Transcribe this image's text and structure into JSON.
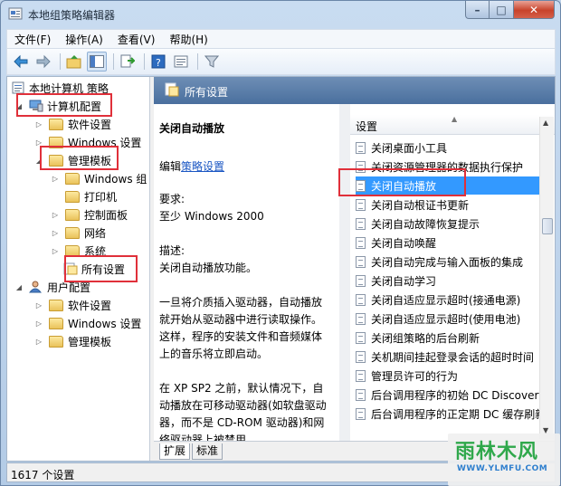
{
  "window": {
    "title": "本地组策略编辑器"
  },
  "menu": [
    "文件(F)",
    "操作(A)",
    "查看(V)",
    "帮助(H)"
  ],
  "tree": {
    "root": "本地计算机 策略",
    "items": [
      {
        "label": "计算机配置"
      },
      {
        "label": "软件设置"
      },
      {
        "label": "Windows 设置"
      },
      {
        "label": "管理模板"
      },
      {
        "label": "Windows 组"
      },
      {
        "label": "打印机"
      },
      {
        "label": "控制面板"
      },
      {
        "label": "网络"
      },
      {
        "label": "系统"
      },
      {
        "label": "所有设置"
      },
      {
        "label": "用户配置"
      },
      {
        "label": "软件设置"
      },
      {
        "label": "Windows 设置"
      },
      {
        "label": "管理模板"
      }
    ]
  },
  "right_header": "所有设置",
  "description": {
    "title": "关闭自动播放",
    "edit_prefix": "编辑",
    "edit_link": "策略设置",
    "req_label": "要求:",
    "req_value": "至少 Windows 2000",
    "desc_label": "描述:",
    "desc_value": "关闭自动播放功能。",
    "para1_l1": "一旦将介质插入驱动器，自动播放",
    "para1_l2": "就开始从驱动器中进行读取操作。",
    "para1_l3": "这样，程序的安装文件和音频媒体",
    "para1_l4": "上的音乐将立即启动。",
    "para2_l1": "在 XP SP2 之前，默认情况下，自",
    "para2_l2": "动播放在可移动驱动器(如软盘驱动",
    "para2_l3": "器，而不是 CD-ROM 驱动器)和网",
    "para2_l4": "络驱动器上被禁用。"
  },
  "settings": {
    "header": "设置",
    "rows": [
      "关闭桌面小工具",
      "关闭资源管理器的数据执行保护",
      "关闭自动播放",
      "关闭自动根证书更新",
      "关闭自动故障恢复提示",
      "关闭自动唤醒",
      "关闭自动完成与输入面板的集成",
      "关闭自动学习",
      "关闭自适应显示超时(接通电源)",
      "关闭自适应显示超时(使用电池)",
      "关闭组策略的后台刷新",
      "关机期间挂起登录会话的超时时间",
      "管理员许可的行为",
      "后台调用程序的初始 DC Discovery",
      "后台调用程序的正定期 DC 缓存刷新"
    ],
    "selected_index": 2
  },
  "tabs": [
    "扩展",
    "标准"
  ],
  "status": "1617 个设置",
  "watermark": {
    "main": "雨林木风",
    "sub": "WWW.YLMFU.COM"
  },
  "colors": {
    "highlight": "#e0303a",
    "selection": "#3399ff",
    "link": "#1a56c3"
  }
}
